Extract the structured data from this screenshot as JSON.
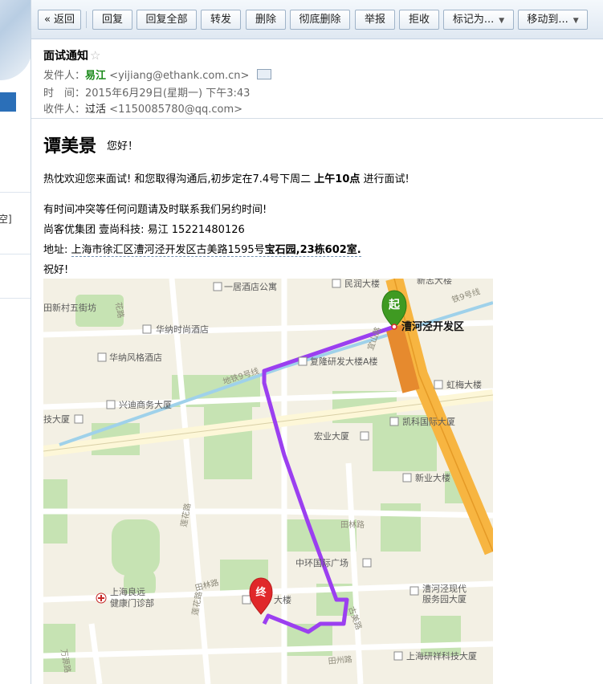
{
  "sidebar": {
    "partial_text": "空]"
  },
  "toolbar": {
    "back": "« 返回",
    "reply": "回复",
    "reply_all": "回复全部",
    "forward": "转发",
    "delete": "删除",
    "delete_permanent": "彻底删除",
    "report": "举报",
    "reject": "拒收",
    "mark_as": "标记为...",
    "move_to": "移动到..."
  },
  "header": {
    "subject": "面试通知",
    "star": "☆",
    "from_label": "发件人：",
    "from_name": "易江",
    "from_addr": "<yijiang@ethank.com.cn>",
    "time_label": "时　间：",
    "time_value": "2015年6月29日(星期一) 下午3:43",
    "to_label": "收件人：",
    "to_name": "过活",
    "to_addr": "<1150085780@qq.com>"
  },
  "body": {
    "greeting_name": "谭美景",
    "greeting_hello": "您好！",
    "line1_pre": "热忱欢迎您来面试! 和您取得沟通后,初步定在7.4号下周二",
    "line1_bold": "上午10点",
    "line1_post": "进行面试!",
    "line2": "有时间冲突等任何问题请及时联系我们另约时间!",
    "line3": "尚客优集团 壹尚科技: 易江 15221480126",
    "line4_label": "地址:",
    "line4_pre": "上海市徐汇区漕河泾开发区古美路1595号",
    "line4_bold": "宝石园,23栋602室.",
    "line5": "祝好!"
  },
  "map": {
    "start_marker": "起",
    "end_marker": "终",
    "start_label": "漕河泾开发区",
    "colors": {
      "route": "#9b3ff0",
      "start": "#3f9a22",
      "end": "#e0282a",
      "highway": "#f7b541",
      "metro": "#9fd1ea"
    },
    "poi": {
      "yiju": "一居酒店公寓",
      "minrun": "民润大楼",
      "xinzhi": "新志大楼",
      "xincun": "田新村五街坊",
      "huana_shishang": "华纳时尚酒店",
      "huana_fengge": "华纳风格酒店",
      "fulong": "复隆研发大楼A楼",
      "hongmei": "虹梅大楼",
      "xingdi": "兴迪商务大厦",
      "jida": "技大厦",
      "kaike": "凯科国际大厦",
      "hongye": "宏业大厦",
      "xinye": "新业大楼",
      "zhonghuan": "中环国际广场",
      "liangyuan_1": "上海良远",
      "liangyuan_2": "健康门诊部",
      "dalou": "大楼",
      "fuwuyuan_1": "漕河泾现代",
      "fuwuyuan_2": "服务园大厦",
      "yanfa": "上海研祥科技大厦"
    },
    "roads": {
      "metro_line": "地铁9号线",
      "metro_line2": "铁9号线",
      "lianhua": "莲花路",
      "tianlin": "田林路",
      "tianlin2": "田林路",
      "gumei": "古美路",
      "tianzhou": "田州路",
      "wancheng": "万源路",
      "yishan": "宜山路",
      "huashan": "花路"
    }
  }
}
